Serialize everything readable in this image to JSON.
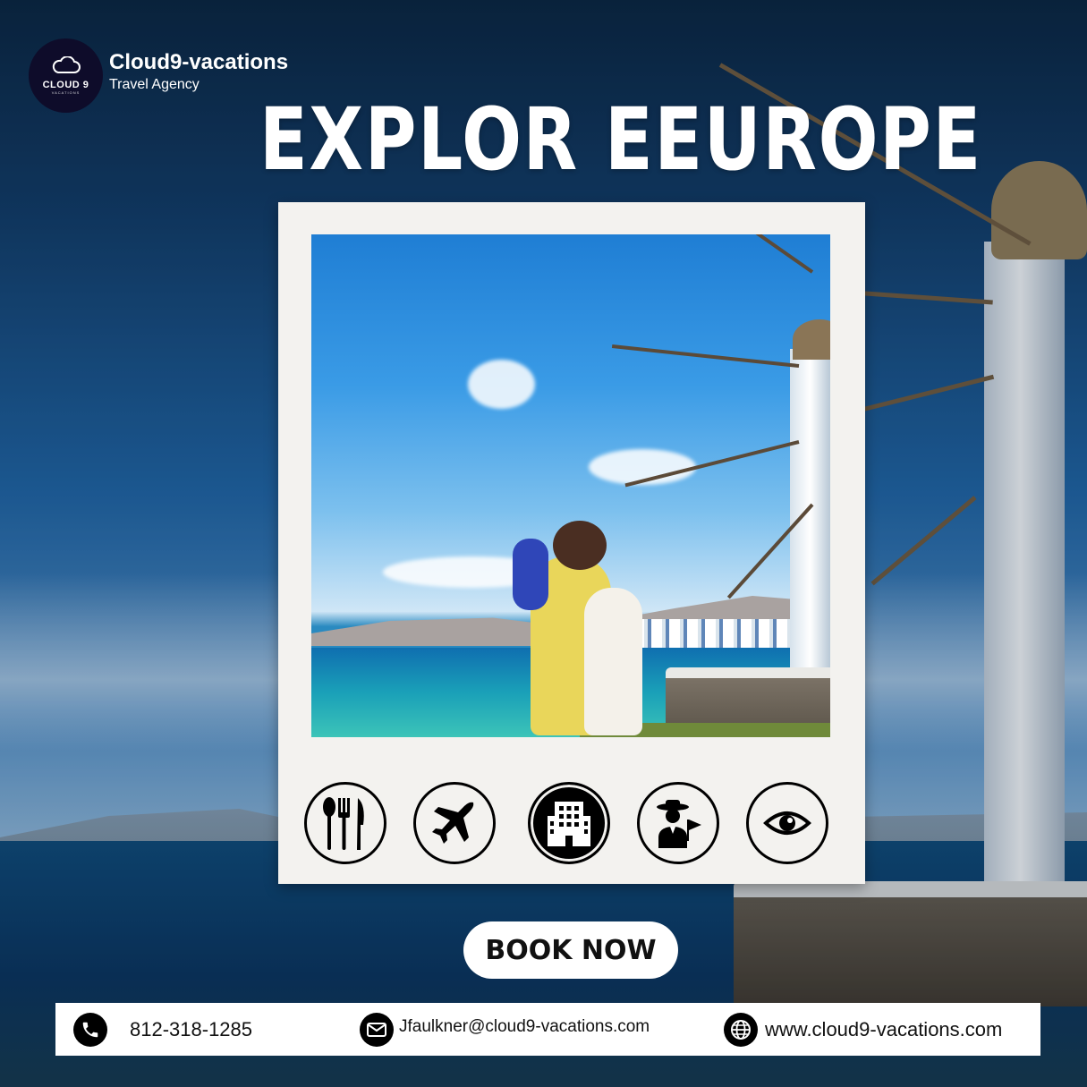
{
  "brand": {
    "logo_text": "CLOUD 9",
    "logo_sub": "VACATIONS",
    "name": "Cloud9-vacations",
    "tagline": "Travel Agency"
  },
  "headline": "EXPLOR EEUROPE",
  "services": [
    {
      "icon": "cutlery-icon"
    },
    {
      "icon": "airplane-icon"
    },
    {
      "icon": "hotel-building-icon"
    },
    {
      "icon": "tour-guide-icon"
    },
    {
      "icon": "eye-icon"
    }
  ],
  "cta": {
    "label": "BOOK NOW"
  },
  "contact": {
    "phone": "812-318-1285",
    "email": "Jfaulkner@cloud9-vacations.com",
    "website": "www.cloud9-vacations.com"
  },
  "colors": {
    "logo_bg": "#0e0c2a",
    "card_bg": "#f3f2ef",
    "text_light": "#ffffff",
    "text_dark": "#111111"
  }
}
